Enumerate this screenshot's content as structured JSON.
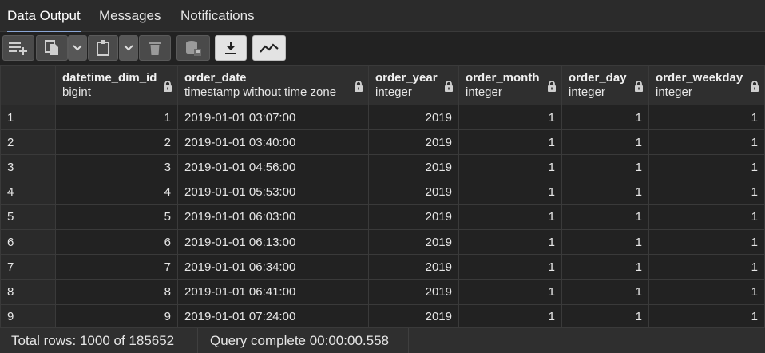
{
  "tabs": [
    {
      "label": "Data Output"
    },
    {
      "label": "Messages"
    },
    {
      "label": "Notifications"
    }
  ],
  "toolbar": {
    "buttons": [
      "add-row-icon",
      "copy-icon",
      "chevron-down-icon",
      "paste-icon",
      "chevron-down-icon",
      "delete-icon",
      "save-data-icon",
      "download-icon",
      "graph-icon"
    ]
  },
  "columns": [
    {
      "name": "datetime_dim_id",
      "type": "bigint"
    },
    {
      "name": "order_date",
      "type": "timestamp without time zone"
    },
    {
      "name": "order_year",
      "type": "integer"
    },
    {
      "name": "order_month",
      "type": "integer"
    },
    {
      "name": "order_day",
      "type": "integer"
    },
    {
      "name": "order_weekday",
      "type": "integer"
    }
  ],
  "rows": [
    {
      "rn": "1",
      "c": [
        "1",
        "2019-01-01 03:07:00",
        "2019",
        "1",
        "1",
        "1"
      ]
    },
    {
      "rn": "2",
      "c": [
        "2",
        "2019-01-01 03:40:00",
        "2019",
        "1",
        "1",
        "1"
      ]
    },
    {
      "rn": "3",
      "c": [
        "3",
        "2019-01-01 04:56:00",
        "2019",
        "1",
        "1",
        "1"
      ]
    },
    {
      "rn": "4",
      "c": [
        "4",
        "2019-01-01 05:53:00",
        "2019",
        "1",
        "1",
        "1"
      ]
    },
    {
      "rn": "5",
      "c": [
        "5",
        "2019-01-01 06:03:00",
        "2019",
        "1",
        "1",
        "1"
      ]
    },
    {
      "rn": "6",
      "c": [
        "6",
        "2019-01-01 06:13:00",
        "2019",
        "1",
        "1",
        "1"
      ]
    },
    {
      "rn": "7",
      "c": [
        "7",
        "2019-01-01 06:34:00",
        "2019",
        "1",
        "1",
        "1"
      ]
    },
    {
      "rn": "8",
      "c": [
        "8",
        "2019-01-01 06:41:00",
        "2019",
        "1",
        "1",
        "1"
      ]
    },
    {
      "rn": "9",
      "c": [
        "9",
        "2019-01-01 07:24:00",
        "2019",
        "1",
        "1",
        "1"
      ]
    }
  ],
  "status": {
    "total_rows": "Total rows: 1000 of 185652",
    "query": "Query complete 00:00:00.558"
  }
}
